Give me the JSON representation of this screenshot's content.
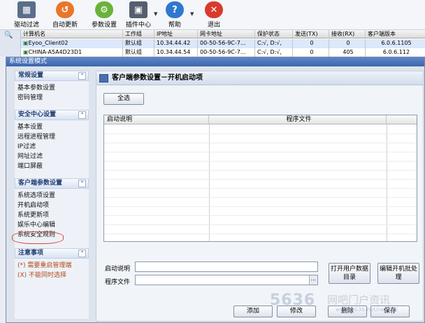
{
  "toolbar": {
    "items": [
      {
        "label": "驱动过滤",
        "icon": "driver-filter-icon",
        "color": "#5a6e8c"
      },
      {
        "label": "自动更新",
        "icon": "auto-update-icon",
        "color": "#e8762a"
      },
      {
        "label": "参数设置",
        "icon": "settings-gear-icon",
        "color": "#6ab23c"
      },
      {
        "label": "插件中心",
        "icon": "plugin-icon",
        "color": "#55606e"
      },
      {
        "label": "帮助",
        "icon": "help-icon",
        "color": "#2f78cf"
      },
      {
        "label": "退出",
        "icon": "exit-icon",
        "color": "#d83b2c"
      }
    ]
  },
  "client_table": {
    "headers": [
      "计算机名",
      "工作组",
      "IP地址",
      "网卡地址",
      "保护状态",
      "发送(TX)",
      "接收(RX)",
      "客户端版本"
    ],
    "rows": [
      [
        "Eyoo_Client02",
        "默认组",
        "10.34.44.42",
        "00-50-56-9C-7...",
        "C:√, D:√,",
        "0",
        "0",
        "6.0.6.1105"
      ],
      [
        "CHINA-A5A4D23D1",
        "默认组",
        "10.34.44.54",
        "00-50-56-9C-7...",
        "C:√, D:√,",
        "0",
        "405",
        "6.0.6.112"
      ]
    ]
  },
  "dialog": {
    "title": "系统设置模式",
    "sections": [
      {
        "title": "常规设置",
        "items": [
          "基本参数设置",
          "密码管理"
        ]
      },
      {
        "title": "安全中心设置",
        "items": [
          "基本设置",
          "远程进程管理",
          "IP过滤",
          "网址过滤",
          "端口屏蔽"
        ]
      },
      {
        "title": "客户端参数设置",
        "items": [
          "系统选项设置",
          "开机启动项",
          "系统更新项",
          "娱乐中心编辑",
          "系统安全规则"
        ]
      }
    ],
    "notes": {
      "title": "注意事项",
      "items": [
        "(*) 需要重启管理端",
        "(X) 不能同时选择"
      ]
    },
    "panel": {
      "title": "客户端参数设置－开机启动项",
      "select_all": "全选",
      "columns": [
        "启动说明",
        "程序文件"
      ],
      "startup_desc_label": "启动说明",
      "startup_desc_value": "",
      "program_file_label": "程序文件",
      "program_file_value": "",
      "browse_label": "...",
      "open_user_dir_button": "打开用户数据目录",
      "batch_edit_button": "编辑开机批处理",
      "add_button": "添加",
      "modify_button": "修改",
      "delete_button": "删除",
      "save_button": "保存"
    }
  },
  "watermark": {
    "brand": "5636",
    "text": "网吧门户资讯",
    "url": "www.5636.net/netbar/"
  }
}
